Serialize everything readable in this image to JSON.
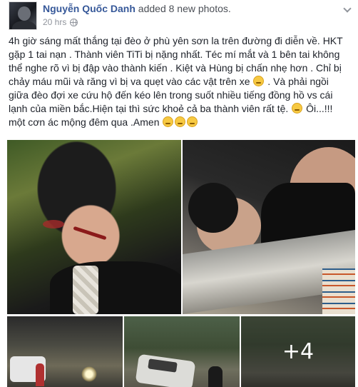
{
  "post": {
    "author": "Nguyễn Quốc Danh",
    "action": " added 8 new photos.",
    "time": "20 hrs",
    "privacy_icon": "globe-icon",
    "menu_icon": "chevron-down-icon",
    "text_part1": "4h giờ sáng mất thắng tại đèo ở phù yên sơn la trên đường đi diễn về. HKT gặp 1 tai nạn . Thành viên TiTi bị nặng nhất. Téc mí mắt và 1 bên tai không thể nghe rõ vì bị đập vào thành kiến . Kiệt và Hùng bị chấn nhẹ hơn . Chỉ bị chảy máu mũi và răng vì bị va quẹt vào các vật trên xe",
    "text_part2": ". Và phải ngồi giữa đèo đợi xe cứu hộ đến kéo lên trong suốt nhiều tiếng đồng hồ vs cái lạnh của miền bắc.Hiện tại thì sức khoẻ cả ba thành viên rất tệ.",
    "text_part3": " Ôi...!!! một cơn ác mộng đêm qua .Amen",
    "more_photos": "+4"
  }
}
